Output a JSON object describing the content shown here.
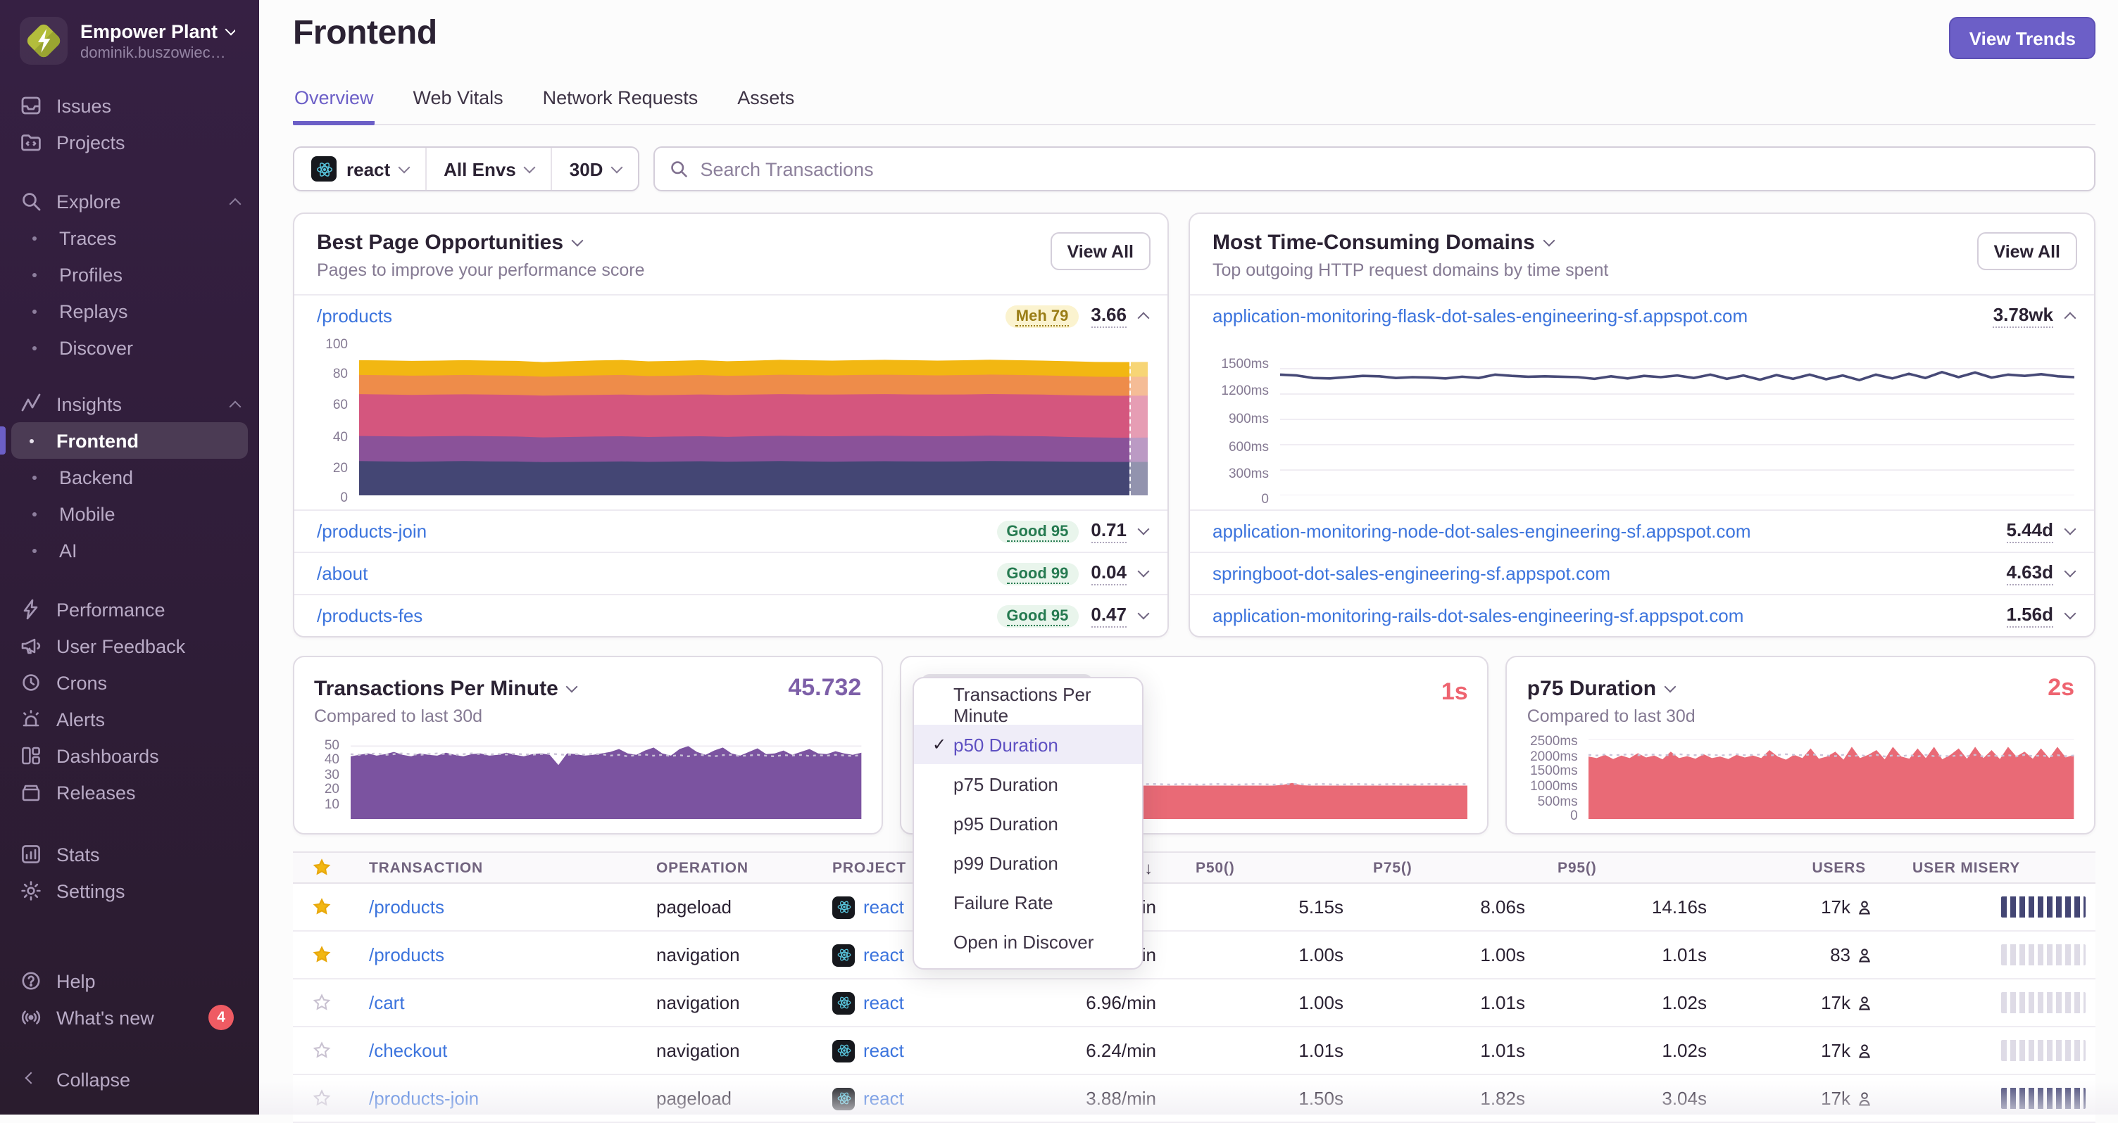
{
  "sidebar": {
    "org": {
      "name": "Empower Plant",
      "sub": "dominik.buszowiec…"
    },
    "items_top": [
      "Issues",
      "Projects"
    ],
    "explore": {
      "label": "Explore",
      "children": [
        "Traces",
        "Profiles",
        "Replays",
        "Discover"
      ]
    },
    "insights": {
      "label": "Insights",
      "children": [
        "Frontend",
        "Backend",
        "Mobile",
        "AI"
      ],
      "active": "Frontend"
    },
    "items_mid": [
      "Performance",
      "User Feedback",
      "Crons",
      "Alerts",
      "Dashboards",
      "Releases"
    ],
    "items_low": [
      "Stats",
      "Settings"
    ],
    "help": "Help",
    "whats_new": "What's new",
    "whats_new_badge": "4",
    "collapse": "Collapse"
  },
  "header": {
    "title": "Frontend",
    "action": "View Trends"
  },
  "tabs": [
    "Overview",
    "Web Vitals",
    "Network Requests",
    "Assets"
  ],
  "filters": {
    "project": "react",
    "env": "All Envs",
    "range": "30D",
    "search_placeholder": "Search Transactions"
  },
  "best_pages": {
    "title": "Best Page Opportunities",
    "subtitle": "Pages to improve your performance score",
    "view_all": "View All",
    "expanded_row": {
      "path": "/products",
      "badge": "Meh 79",
      "value": "3.66"
    },
    "rows": [
      {
        "path": "/products-join",
        "badge": "Good 95",
        "value": "0.71"
      },
      {
        "path": "/about",
        "badge": "Good 99",
        "value": "0.04"
      },
      {
        "path": "/products-fes",
        "badge": "Good 95",
        "value": "0.47"
      }
    ],
    "yticks": [
      "100",
      "80",
      "60",
      "40",
      "20",
      "0"
    ],
    "chart": {
      "type": "stacked-area",
      "ymax": 100,
      "series": [
        {
          "type": "area",
          "color": "#F2B712",
          "values": [
            91.5,
            91.3,
            91,
            91.2,
            91.5,
            91.2,
            91,
            90.2,
            90.8,
            91.3,
            91.6,
            90.7,
            91,
            91.5,
            90.8,
            91.2,
            91.7,
            91.4,
            91.2,
            91.5,
            91.7,
            91.5,
            91.2,
            91.4,
            91.8,
            91.5,
            91.2,
            90.8,
            90.3,
            90.2,
            90.3
          ]
        },
        {
          "type": "area",
          "color": "#EE8C4A",
          "values": [
            81.5,
            81.3,
            81,
            81.2,
            81.5,
            81.2,
            81,
            80.3,
            80.8,
            81.2,
            81.5,
            80.8,
            81,
            81.4,
            80.9,
            81.2,
            81.6,
            81.4,
            81.2,
            81.5,
            81.6,
            81.4,
            81.2,
            81.4,
            81.7,
            81.5,
            81.2,
            80.8,
            80.3,
            80.2,
            80.3
          ]
        },
        {
          "type": "area",
          "color": "#D4567E",
          "values": [
            68.5,
            68.3,
            68,
            68.2,
            68.4,
            68.2,
            68,
            67.5,
            67.8,
            68,
            68.2,
            67.8,
            68,
            68.3,
            67.9,
            68.2,
            68.5,
            68.3,
            68.2,
            68.4,
            68.5,
            68.3,
            68.2,
            68.3,
            68.6,
            68.4,
            68.2,
            67.8,
            67.5,
            67.4,
            67.5
          ]
        },
        {
          "type": "area",
          "color": "#8A5299",
          "values": [
            40.2,
            40,
            39.8,
            40,
            40.2,
            40,
            39.8,
            39.2,
            39.5,
            39.8,
            40,
            39.5,
            39.8,
            40,
            39.6,
            40,
            40.3,
            40.1,
            40,
            40.2,
            40.3,
            40.1,
            40,
            40.1,
            40.4,
            40.2,
            40,
            39.5,
            39.2,
            39,
            39.1
          ]
        },
        {
          "type": "area",
          "color": "#444674",
          "values": [
            23.2,
            23,
            22.8,
            23,
            23.2,
            23,
            22.9,
            22.5,
            22.6,
            22.8,
            23,
            22.7,
            22.9,
            23.1,
            22.8,
            23,
            23.2,
            23,
            22.8,
            23,
            23.1,
            23,
            22.9,
            23,
            23.2,
            23.1,
            23,
            22.8,
            22.7,
            22.6,
            22.6
          ]
        }
      ]
    }
  },
  "domains": {
    "title": "Most Time-Consuming Domains",
    "subtitle": "Top outgoing HTTP request domains by time spent",
    "view_all": "View All",
    "expanded_row": {
      "host": "application-monitoring-flask-dot-sales-engineering-sf.appspot.com",
      "value": "3.78wk"
    },
    "rows": [
      {
        "host": "application-monitoring-node-dot-sales-engineering-sf.appspot.com",
        "value": "5.44d"
      },
      {
        "host": "springboot-dot-sales-engineering-sf.appspot.com",
        "value": "4.63d"
      },
      {
        "host": "application-monitoring-rails-dot-sales-engineering-sf.appspot.com",
        "value": "1.56d"
      }
    ],
    "yticks": [
      "1500ms",
      "1200ms",
      "900ms",
      "600ms",
      "300ms",
      "0"
    ],
    "chart": {
      "type": "line",
      "ymax": 1750,
      "grid": [
        1500,
        1200,
        900,
        600,
        300,
        0
      ],
      "series": [
        {
          "type": "line",
          "color": "#474A77",
          "w": 1.8,
          "values": [
            1430,
            1420,
            1390,
            1385,
            1400,
            1415,
            1410,
            1390,
            1400,
            1395,
            1385,
            1405,
            1390,
            1430,
            1415,
            1405,
            1410,
            1405,
            1400,
            1380,
            1410,
            1385,
            1415,
            1400,
            1420,
            1390,
            1430,
            1380,
            1420,
            1370,
            1425,
            1380,
            1430,
            1375,
            1420,
            1365,
            1430,
            1385,
            1440,
            1390,
            1460,
            1400,
            1455,
            1395,
            1430,
            1415,
            1435,
            1410,
            1400
          ]
        }
      ]
    }
  },
  "metrics": {
    "tpm": {
      "title": "Transactions Per Minute",
      "value": "45.732",
      "subtitle": "Compared to last 30d",
      "yticks": [
        "50",
        "40",
        "30",
        "20",
        "10"
      ],
      "chart": {
        "type": "area",
        "ymax": 55,
        "grid": [
          50
        ],
        "series": [
          {
            "type": "area",
            "color": "#7B53A0",
            "values": [
              43,
              44,
              45,
              43.5,
              44.5,
              46,
              44,
              43,
              45,
              44,
              43.5,
              45.5,
              44,
              43,
              44.5,
              45,
              43.5,
              44,
              45.5,
              44,
              43,
              44.5,
              45,
              44,
              37,
              45,
              44.5,
              43.5,
              44,
              45,
              46,
              48,
              45,
              44,
              47,
              49,
              45,
              43.5,
              48,
              50,
              46,
              44,
              47,
              49,
              45,
              43.5,
              46,
              48.5,
              44.5,
              45,
              47,
              44,
              46,
              48,
              45,
              44.5,
              46.5,
              45,
              44,
              45.5
            ]
          },
          {
            "type": "line",
            "dash": "2 3",
            "w": 1.2,
            "color": "#C9C1D6",
            "values": [
              44.5,
              44,
              44.5,
              45,
              44,
              44.5,
              45,
              44.5,
              44,
              44.5,
              45,
              44.5,
              44,
              44.5,
              45,
              44.5,
              44.3,
              44.6,
              44.2,
              44.8,
              44.4,
              44.1,
              44.6,
              44.9,
              44.3,
              44,
              44.5,
              44.2,
              44.7,
              44.4,
              43.5,
              44,
              43,
              43.8,
              44.2,
              43.4,
              44,
              43.2,
              43.8,
              43,
              44.2,
              43.6,
              43,
              43.8,
              44,
              43.2,
              43.6,
              44,
              43.4,
              43,
              43.8,
              43.5,
              44,
              43.2,
              43.8,
              43.4,
              44,
              43.6,
              43.2,
              43.8
            ]
          }
        ]
      }
    },
    "p50": {
      "title": "p50 Duration",
      "value": "1s",
      "chart": {
        "type": "area",
        "ymax": 2.4,
        "series": [
          {
            "type": "area",
            "color": "#E96A76",
            "values": [
              1,
              1,
              1,
              1,
              1,
              1.01,
              1,
              1,
              1,
              1,
              1,
              1.01,
              1,
              1,
              1,
              1,
              1,
              1,
              1,
              1.02,
              1.28,
              1.02,
              1,
              1,
              1,
              1,
              1,
              1,
              1,
              1,
              1,
              1,
              1,
              1,
              1,
              1,
              1,
              1,
              1,
              1.02,
              1.08,
              1.01,
              1,
              1,
              1,
              1,
              1,
              1,
              1,
              1,
              1,
              1,
              1,
              1,
              1,
              1,
              1,
              1,
              1,
              1
            ]
          },
          {
            "type": "line",
            "dash": "2 3",
            "w": 1.2,
            "color": "#C9C1D6",
            "values": [
              1.04,
              1.03,
              1.05,
              1.04,
              1.03,
              1.04,
              1.05,
              1.04,
              1.03,
              1.04,
              1.05,
              1.04,
              1.03,
              1.05,
              1.04,
              1.03,
              1.04,
              1.05,
              1.04,
              1.03,
              1.04,
              1.05,
              1.04,
              1.03,
              1.04,
              1.05,
              1.04,
              1.03,
              1.05,
              1.04,
              1.03,
              1.04,
              1.05,
              1.04,
              1.03,
              1.04,
              1.05,
              1.04,
              1.03,
              1.04,
              1.05,
              1.04,
              1.03,
              1.05,
              1.04,
              1.03,
              1.04,
              1.05,
              1.04,
              1.03,
              1.04,
              1.05,
              1.04,
              1.03,
              1.04,
              1.05,
              1.04,
              1.03,
              1.05,
              1.04
            ]
          }
        ]
      }
    },
    "p75": {
      "title": "p75 Duration",
      "value": "2s",
      "subtitle": "Compared to last 30d",
      "yticks": [
        "2500ms",
        "2000ms",
        "1500ms",
        "1000ms",
        "500ms",
        "0"
      ],
      "chart": {
        "type": "area",
        "ymax": 2500,
        "grid": [
          2500
        ],
        "series": [
          {
            "type": "area",
            "color": "#E96A76",
            "values": [
              1950,
              1900,
              2000,
              1870,
              1980,
              1900,
              2050,
              1920,
              1980,
              1860,
              2100,
              1900,
              1960,
              1880,
              2020,
              1900,
              1950,
              1870,
              2000,
              1920,
              1980,
              1900,
              2150,
              1950,
              1850,
              2000,
              1900,
              2200,
              1880,
              1950,
              2100,
              1850,
              2250,
              1900,
              2000,
              2150,
              1860,
              2250,
              1950,
              1880,
              2200,
              1900,
              2250,
              1860,
              2000,
              2200,
              1880,
              2250,
              1900,
              2150,
              1870,
              2250,
              1950,
              2100,
              1880,
              2200,
              1900,
              2250,
              1920,
              2000
            ]
          },
          {
            "type": "line",
            "dash": "2 3",
            "w": 1.2,
            "color": "#C9C1D6",
            "values": [
              2000,
              1980,
              2010,
              1990,
              2000,
              2020,
              1990,
              2000,
              2010,
              1980,
              2000,
              2020,
              2000,
              1990,
              2010,
              2000,
              1980,
              2000,
              2020,
              1990,
              2000,
              2010,
              1980,
              2000,
              2020,
              2000,
              1990,
              2010,
              2000,
              1980,
              1960,
              2000,
              1950,
              1990,
              1960,
              2000,
              1950,
              1980,
              1960,
              1990,
              1950,
              2000,
              1960,
              1980,
              1950,
              1990,
              1960,
              2000,
              1950,
              1980,
              1960,
              1990,
              1950,
              2000,
              1960,
              1980,
              1950,
              1990,
              1960,
              1980
            ]
          }
        ]
      }
    }
  },
  "dropdown": {
    "check": "✓",
    "items": [
      {
        "label": "Transactions Per Minute",
        "checked": false
      },
      {
        "label": "p50 Duration",
        "checked": true
      },
      {
        "label": "p75 Duration",
        "checked": false
      },
      {
        "label": "p95 Duration",
        "checked": false
      },
      {
        "label": "p99 Duration",
        "checked": false
      },
      {
        "label": "Failure Rate",
        "checked": false
      },
      {
        "label": "Open in Discover",
        "checked": false
      }
    ]
  },
  "table": {
    "headers": {
      "transaction": "TRANSACTION",
      "operation": "OPERATION",
      "project": "PROJECT",
      "sort": "↓",
      "p50": "P50()",
      "p75": "P75()",
      "p95": "P95()",
      "users": "USERS",
      "misery": "USER MISERY"
    },
    "rows": [
      {
        "starred": true,
        "transaction": "/products",
        "operation": "pageload",
        "project": "react",
        "tpm": "in",
        "p50": "5.15s",
        "p75": "8.06s",
        "p95": "14.16s",
        "users": "17k",
        "misery": "high"
      },
      {
        "starred": true,
        "transaction": "/products",
        "operation": "navigation",
        "project": "react",
        "tpm": "in",
        "p50": "1.00s",
        "p75": "1.00s",
        "p95": "1.01s",
        "users": "83",
        "misery": "low"
      },
      {
        "starred": false,
        "transaction": "/cart",
        "operation": "navigation",
        "project": "react",
        "tpm": "6.96/min",
        "p50": "1.00s",
        "p75": "1.01s",
        "p95": "1.02s",
        "users": "17k",
        "misery": "low"
      },
      {
        "starred": false,
        "transaction": "/checkout",
        "operation": "navigation",
        "project": "react",
        "tpm": "6.24/min",
        "p50": "1.01s",
        "p75": "1.01s",
        "p95": "1.02s",
        "users": "17k",
        "misery": "low"
      },
      {
        "starred": false,
        "transaction": "/products-join",
        "operation": "pageload",
        "project": "react",
        "tpm": "3.88/min",
        "p50": "1.50s",
        "p75": "1.82s",
        "p95": "3.04s",
        "users": "17k",
        "misery": "high"
      }
    ]
  }
}
